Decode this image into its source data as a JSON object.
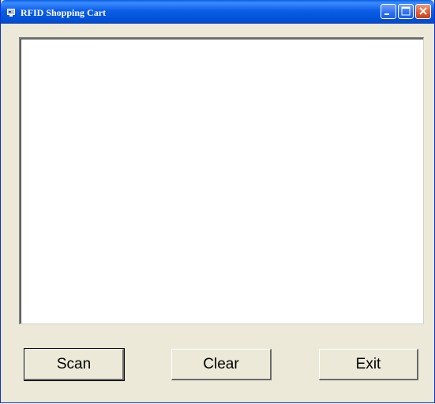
{
  "window": {
    "title": "RFID Shopping Cart",
    "icon": "app-icon",
    "controls": {
      "minimize_icon": "minimize-icon",
      "maximize_icon": "maximize-icon",
      "close_icon": "close-icon"
    },
    "colors": {
      "titlebar": "#0d5ee6",
      "face": "#ece9d8",
      "close": "#e25d33"
    }
  },
  "content": {
    "list_value": ""
  },
  "buttons": {
    "scan_label": "Scan",
    "clear_label": "Clear",
    "exit_label": "Exit"
  }
}
